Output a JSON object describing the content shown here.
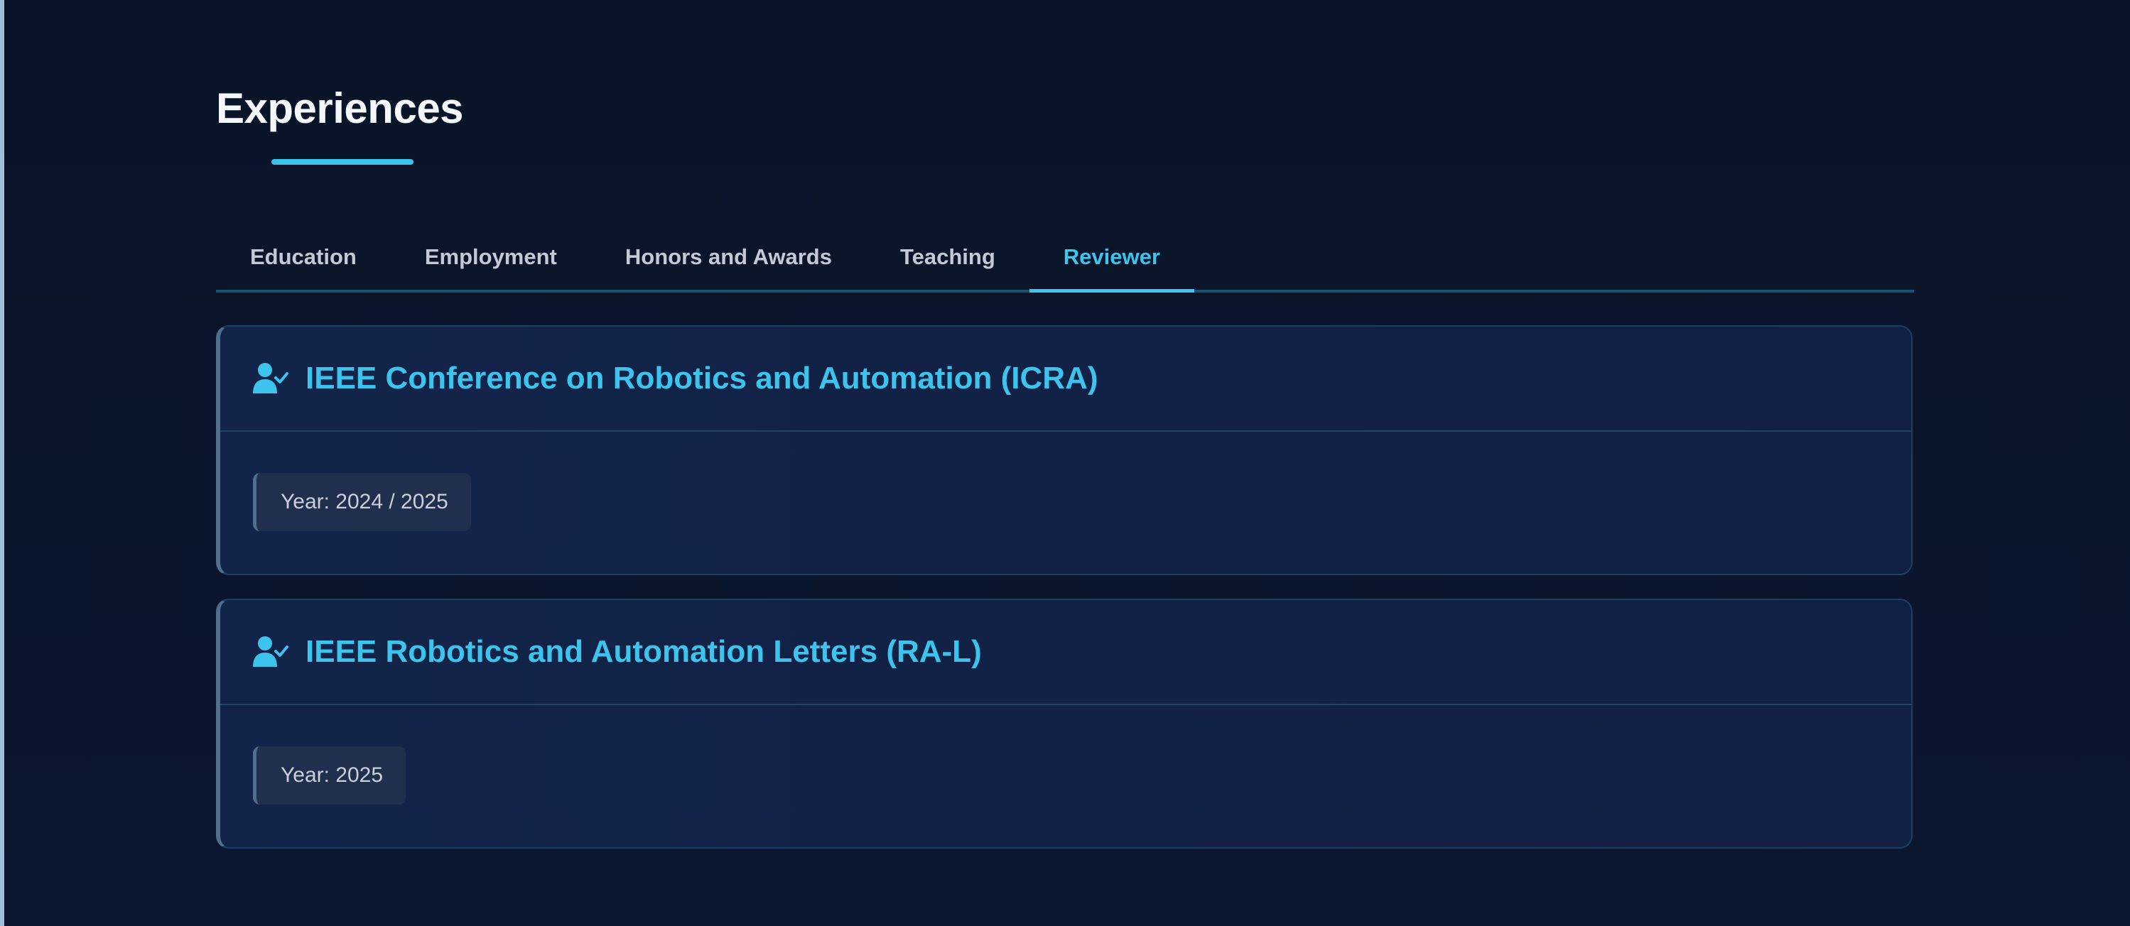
{
  "section": {
    "title": "Experiences"
  },
  "tabs": [
    {
      "label": "Education",
      "active": false
    },
    {
      "label": "Employment",
      "active": false
    },
    {
      "label": "Honors and Awards",
      "active": false
    },
    {
      "label": "Teaching",
      "active": false
    },
    {
      "label": "Reviewer",
      "active": true
    }
  ],
  "reviewer": {
    "items": [
      {
        "icon": "user-check-icon",
        "title": "IEEE Conference on Robotics and Automation (ICRA)",
        "year": "Year: 2024 / 2025"
      },
      {
        "icon": "user-check-icon",
        "title": "IEEE Robotics and Automation Letters (RA-L)",
        "year": "Year: 2025"
      }
    ]
  },
  "colors": {
    "background": "#0a1428",
    "accent": "#3cc4ec",
    "heading": "#f3f6fb",
    "tab_text": "#c3cad6"
  }
}
